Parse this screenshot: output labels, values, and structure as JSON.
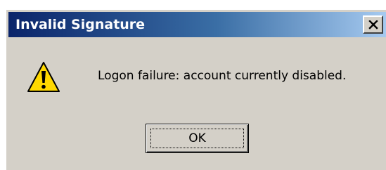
{
  "window": {
    "title": "Invalid Signature",
    "close_icon": "close-icon"
  },
  "dialog": {
    "icon": "warning-icon",
    "icon_color": "#ffd800",
    "message": "Logon failure: account currently disabled.",
    "ok_label": "OK"
  },
  "colors": {
    "titlebar_start": "#0a246a",
    "titlebar_end": "#a6caf0",
    "dialog_bg": "#d4d0c8"
  }
}
